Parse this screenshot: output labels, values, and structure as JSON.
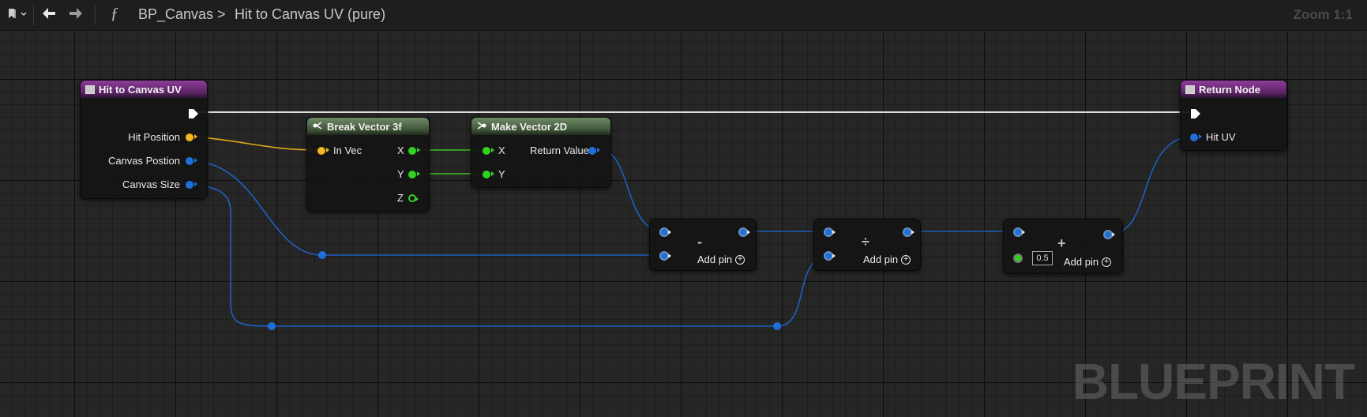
{
  "toolbar": {
    "function_glyph": "ƒ",
    "breadcrumb_graph": "BP_Canvas",
    "breadcrumb_sep": ">",
    "breadcrumb_function": "Hit to Canvas UV (pure)",
    "zoom": "Zoom 1:1",
    "icons": [
      "bookmark-icon",
      "chevron-down-icon",
      "back-arrow-icon",
      "forward-arrow-icon",
      "function-icon"
    ]
  },
  "watermark": "BLUEPRINT",
  "colors": {
    "float_pin": "#f2b820",
    "vector2d_pin": "#1f6fd8",
    "float_component_pin": "#2fd21f",
    "func_header": "#6b2a78",
    "pure_header": "#4d6446",
    "exec_wire": "#e0e0e0"
  },
  "nodes": {
    "entry": {
      "title": "Hit to Canvas UV",
      "outputs": [
        "Hit Position",
        "Canvas Postion",
        "Canvas Size"
      ]
    },
    "break": {
      "title": "Break Vector 3f",
      "input": "In Vec",
      "outputs": [
        "X",
        "Y",
        "Z"
      ]
    },
    "make": {
      "title": "Make Vector 2D",
      "inputs": [
        "X",
        "Y"
      ],
      "output": "Return Value"
    },
    "subtract": {
      "op": "-",
      "add_pin": "Add pin"
    },
    "divide": {
      "op": "÷",
      "add_pin": "Add pin"
    },
    "add": {
      "op": "+",
      "add_pin": "Add pin",
      "value": "0.5"
    },
    "return": {
      "title": "Return Node",
      "input": "Hit UV"
    }
  }
}
